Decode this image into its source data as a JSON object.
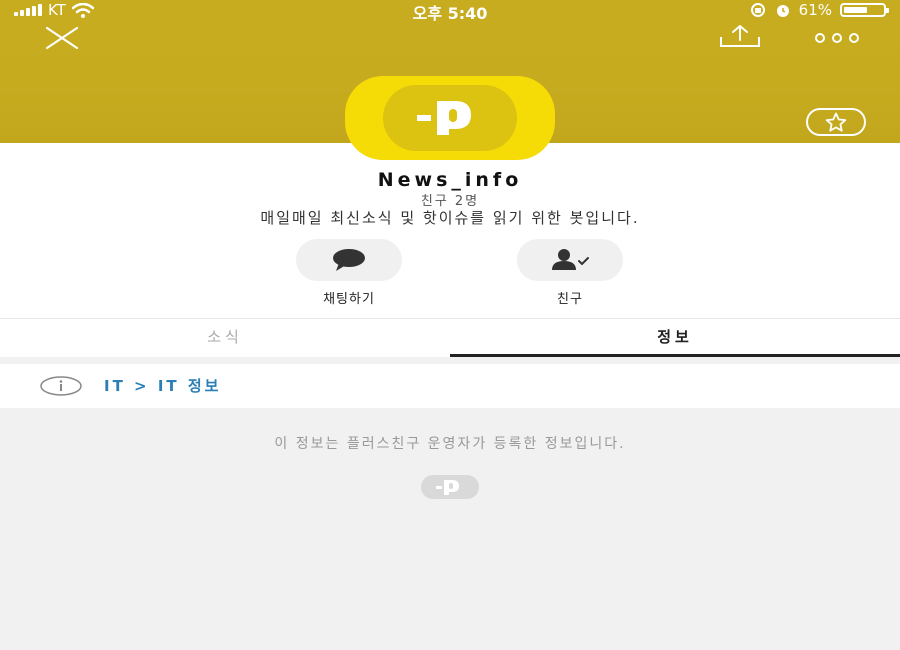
{
  "status_bar": {
    "carrier": "KT",
    "time": "오후 5:40",
    "battery_percent": "61%",
    "battery_level": 0.61
  },
  "profile": {
    "name": "News_info",
    "friends_count": "친구 2명",
    "description": "매일매일 최신소식 및 핫이슈를 읽기 위한 봇입니다."
  },
  "actions": [
    {
      "label": "채팅하기",
      "icon": "chat-bubble-icon"
    },
    {
      "label": "친구",
      "icon": "person-check-icon"
    }
  ],
  "tabs": [
    {
      "label": "소식",
      "active": false
    },
    {
      "label": "정보",
      "active": true
    }
  ],
  "info": {
    "category": "IT > IT 정보",
    "notice": "이 정보는 플러스친구 운영자가 등록한 정보입니다."
  },
  "colors": {
    "header": "#c8ac20",
    "brand_yellow": "#f6dc07",
    "link_blue": "#2a7fb5"
  }
}
